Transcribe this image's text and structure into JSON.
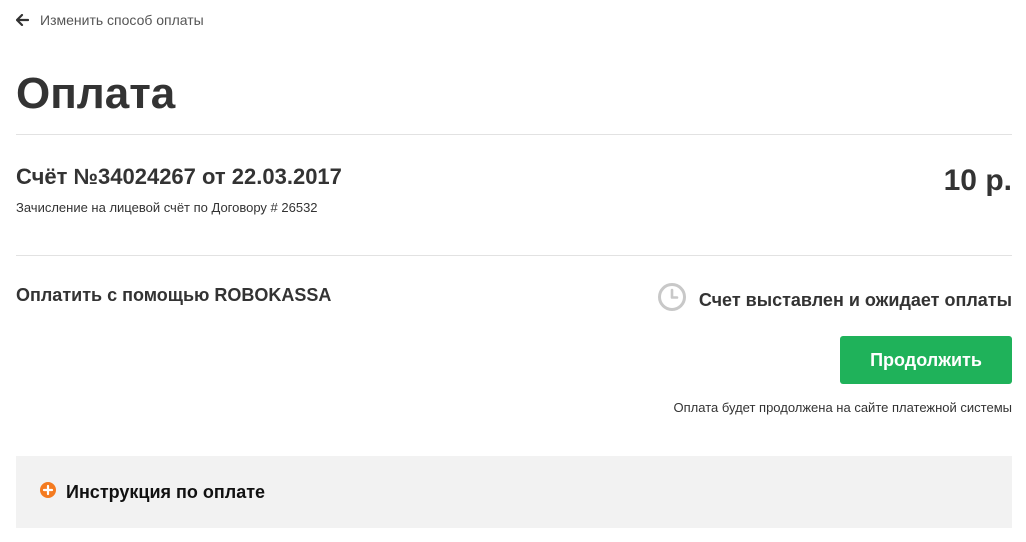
{
  "nav": {
    "back_label": "Изменить способ оплаты",
    "back_icon": "arrow-left-icon"
  },
  "page": {
    "title": "Оплата"
  },
  "invoice": {
    "title": "Счёт №34024267 от 22.03.2017",
    "description": "Зачисление на лицевой счёт по Договору # 26532",
    "amount": "10 р."
  },
  "payment": {
    "method_label": "Оплатить с помощью ROBOKASSA",
    "status_icon": "clock-icon",
    "status_label": "Счет выставлен и ожидает оплаты",
    "continue_label": "Продолжить",
    "redirect_note": "Оплата будет продолжена на сайте платежной системы"
  },
  "instructions": {
    "icon": "plus-circle-icon",
    "label": "Инструкция по оплате"
  },
  "colors": {
    "accent_green": "#1fb25a",
    "expand_icon_orange": "#f47b20",
    "text": "#333333",
    "panel_bg": "#f2f2f2"
  }
}
